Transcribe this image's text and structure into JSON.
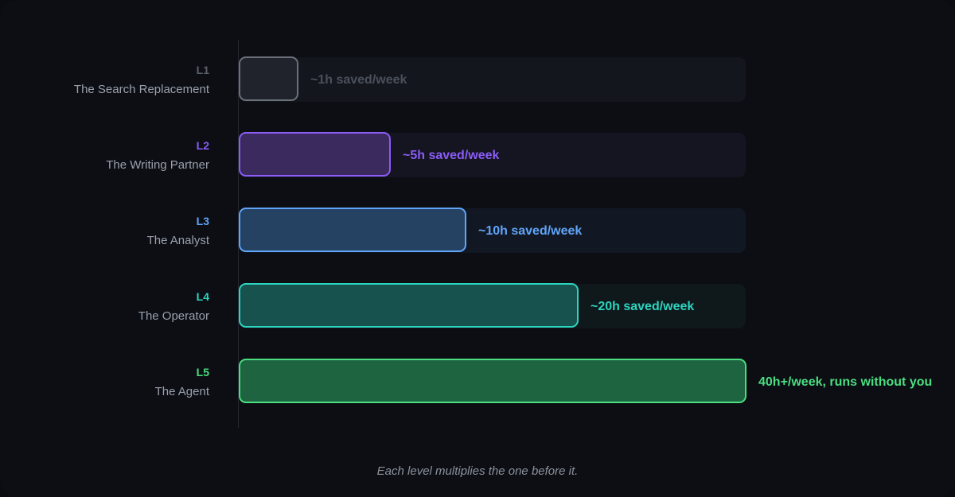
{
  "chart_data": {
    "type": "bar",
    "orientation": "horizontal",
    "categories": [
      "L1",
      "L2",
      "L3",
      "L4",
      "L5"
    ],
    "names": [
      "The Search Replacement",
      "The Writing Partner",
      "The Analyst",
      "The Operator",
      "The Agent"
    ],
    "values": [
      1,
      5,
      10,
      20,
      40
    ],
    "unit": "hours saved per week",
    "value_labels": [
      "~1h saved/week",
      "~5h saved/week",
      "~10h saved/week",
      "~20h saved/week",
      "40h+/week, runs without you"
    ],
    "colors": [
      "#6b7079",
      "#8b5cf6",
      "#60a5fa",
      "#2dd4bf",
      "#4ade80"
    ],
    "fill_colors": [
      "#20232b",
      "#3a2a5e",
      "#264262",
      "#17524f",
      "#1f6441"
    ],
    "track_colors": [
      "#14161d",
      "#141521",
      "#121823",
      "#0f191c",
      "transparent"
    ],
    "label_colors": [
      "#4a505a",
      "#8b5cf6",
      "#60a5fa",
      "#2dd4bf",
      "#4ade80"
    ],
    "code_colors": [
      "#5a6069",
      "#8b5cf6",
      "#60a5fa",
      "#2dd4bf",
      "#4ade80"
    ],
    "grid": false
  },
  "footnote": "Each level multiplies the one before it."
}
